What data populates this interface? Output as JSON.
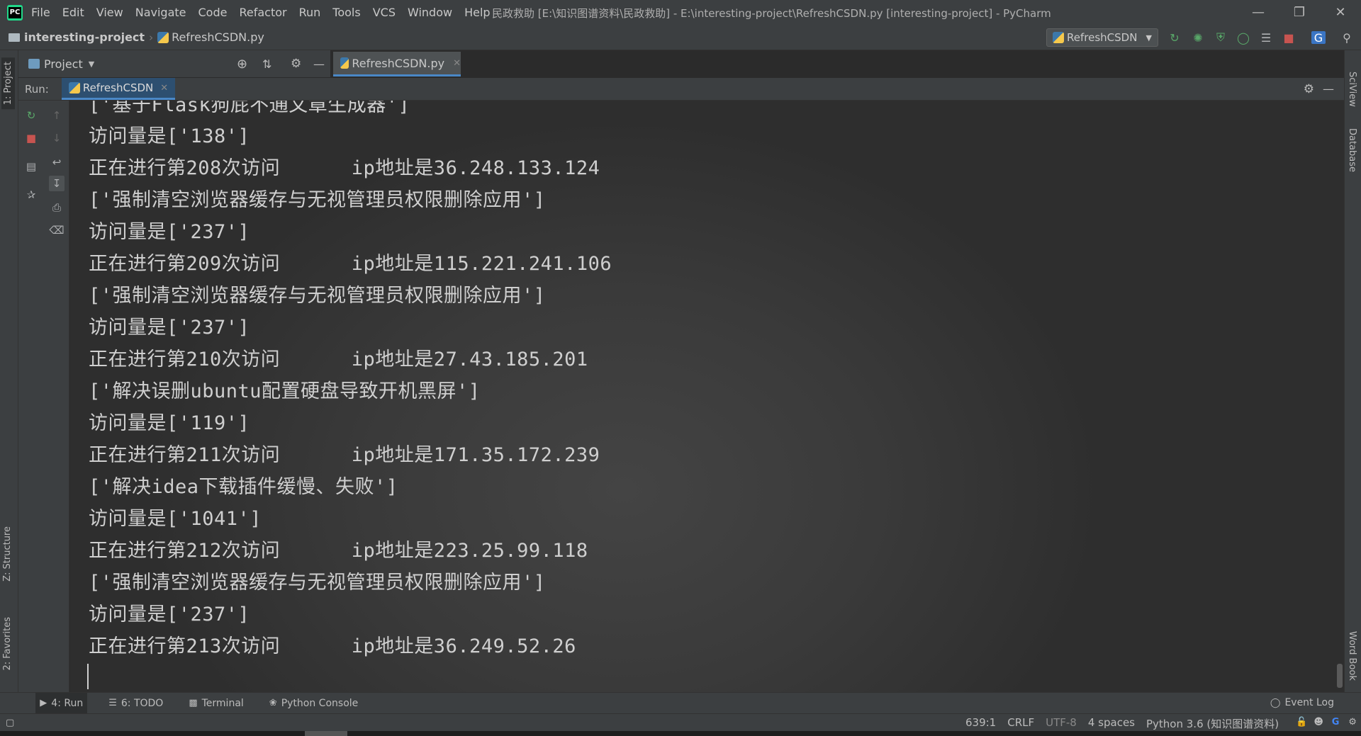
{
  "menubar": {
    "items": [
      "File",
      "Edit",
      "View",
      "Navigate",
      "Code",
      "Refactor",
      "Run",
      "Tools",
      "VCS",
      "Window",
      "Help"
    ],
    "window_title": "民政救助 [E:\\知识图谱资料\\民政救助] - E:\\interesting-project\\RefreshCSDN.py [interesting-project] - PyCharm"
  },
  "navbar": {
    "project": "interesting-project",
    "file": "RefreshCSDN.py",
    "run_config": "RefreshCSDN"
  },
  "left_strip": {
    "project_tab": "1: Project",
    "structure_tab": "Z: Structure",
    "favorites_tab": "2: Favorites"
  },
  "right_strip": {
    "sciview_tab": "SciView",
    "database_tab": "Database",
    "wordbook_tab": "Word Book"
  },
  "project_panel": {
    "title": "Project"
  },
  "editor": {
    "tab_label": "RefreshCSDN.py"
  },
  "run_panel": {
    "label": "Run:",
    "tab_label": "RefreshCSDN"
  },
  "console": {
    "lines": [
      "['基于Flask狗屁不通文章生成器']",
      "访问量是['138']",
      "正在进行第208次访问      ip地址是36.248.133.124",
      "['强制清空浏览器缓存与无视管理员权限删除应用']",
      "访问量是['237']",
      "正在进行第209次访问      ip地址是115.221.241.106",
      "['强制清空浏览器缓存与无视管理员权限删除应用']",
      "访问量是['237']",
      "正在进行第210次访问      ip地址是27.43.185.201",
      "['解决误删ubuntu配置硬盘导致开机黑屏']",
      "访问量是['119']",
      "正在进行第211次访问      ip地址是171.35.172.239",
      "['解决idea下载插件缓慢、失败']",
      "访问量是['1041']",
      "正在进行第212次访问      ip地址是223.25.99.118",
      "['强制清空浏览器缓存与无视管理员权限删除应用']",
      "访问量是['237']",
      "正在进行第213次访问      ip地址是36.249.52.26"
    ]
  },
  "bottom_tabs": {
    "run": "4: Run",
    "todo": "6: TODO",
    "terminal": "Terminal",
    "python_console": "Python Console",
    "event_log": "Event Log"
  },
  "statusbar": {
    "position": "639:1",
    "line_sep": "CRLF",
    "encoding": "UTF-8",
    "indent": "4 spaces",
    "interpreter": "Python 3.6 (知识图谱资料)"
  },
  "colors": {
    "accent": "#4A88C7",
    "run_green": "#59A869",
    "stop_red": "#C75450"
  }
}
